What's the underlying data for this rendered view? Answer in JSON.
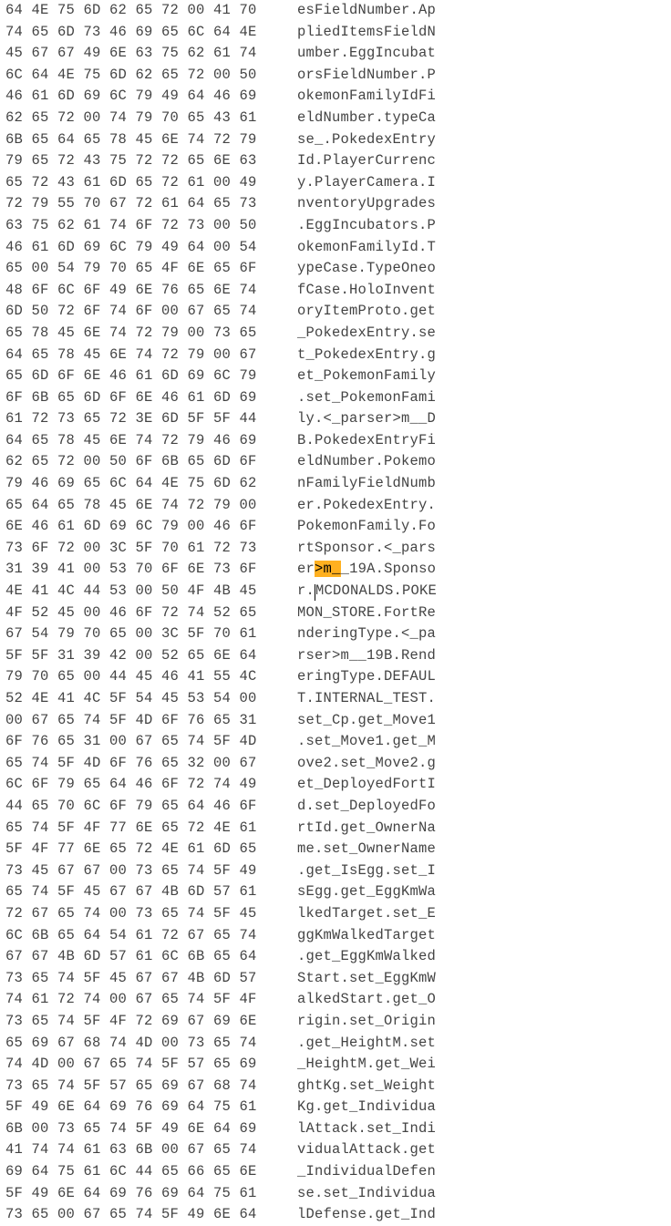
{
  "highlight": {
    "row": 26,
    "start": 2,
    "end": 5
  },
  "caret": {
    "row": 27,
    "col": 2
  },
  "rows": [
    {
      "hex": [
        "64",
        "4E",
        "75",
        "6D",
        "62",
        "65",
        "72",
        "00",
        "41",
        "70"
      ],
      "ascii": "esFieldNumber.Ap"
    },
    {
      "hex": [
        "74",
        "65",
        "6D",
        "73",
        "46",
        "69",
        "65",
        "6C",
        "64",
        "4E"
      ],
      "ascii": "pliedItemsFieldN"
    },
    {
      "hex": [
        "45",
        "67",
        "67",
        "49",
        "6E",
        "63",
        "75",
        "62",
        "61",
        "74"
      ],
      "ascii": "umber.EggIncubat"
    },
    {
      "hex": [
        "6C",
        "64",
        "4E",
        "75",
        "6D",
        "62",
        "65",
        "72",
        "00",
        "50"
      ],
      "ascii": "orsFieldNumber.P"
    },
    {
      "hex": [
        "46",
        "61",
        "6D",
        "69",
        "6C",
        "79",
        "49",
        "64",
        "46",
        "69"
      ],
      "ascii": "okemonFamilyIdFi"
    },
    {
      "hex": [
        "62",
        "65",
        "72",
        "00",
        "74",
        "79",
        "70",
        "65",
        "43",
        "61"
      ],
      "ascii": "eldNumber.typeCa"
    },
    {
      "hex": [
        "6B",
        "65",
        "64",
        "65",
        "78",
        "45",
        "6E",
        "74",
        "72",
        "79"
      ],
      "ascii": "se_.PokedexEntry"
    },
    {
      "hex": [
        "79",
        "65",
        "72",
        "43",
        "75",
        "72",
        "72",
        "65",
        "6E",
        "63"
      ],
      "ascii": "Id.PlayerCurrenc"
    },
    {
      "hex": [
        "65",
        "72",
        "43",
        "61",
        "6D",
        "65",
        "72",
        "61",
        "00",
        "49"
      ],
      "ascii": "y.PlayerCamera.I"
    },
    {
      "hex": [
        "72",
        "79",
        "55",
        "70",
        "67",
        "72",
        "61",
        "64",
        "65",
        "73"
      ],
      "ascii": "nventoryUpgrades"
    },
    {
      "hex": [
        "63",
        "75",
        "62",
        "61",
        "74",
        "6F",
        "72",
        "73",
        "00",
        "50"
      ],
      "ascii": ".EggIncubators.P"
    },
    {
      "hex": [
        "46",
        "61",
        "6D",
        "69",
        "6C",
        "79",
        "49",
        "64",
        "00",
        "54"
      ],
      "ascii": "okemonFamilyId.T"
    },
    {
      "hex": [
        "65",
        "00",
        "54",
        "79",
        "70",
        "65",
        "4F",
        "6E",
        "65",
        "6F"
      ],
      "ascii": "ypeCase.TypeOneo"
    },
    {
      "hex": [
        "48",
        "6F",
        "6C",
        "6F",
        "49",
        "6E",
        "76",
        "65",
        "6E",
        "74"
      ],
      "ascii": "fCase.HoloInvent"
    },
    {
      "hex": [
        "6D",
        "50",
        "72",
        "6F",
        "74",
        "6F",
        "00",
        "67",
        "65",
        "74"
      ],
      "ascii": "oryItemProto.get"
    },
    {
      "hex": [
        "65",
        "78",
        "45",
        "6E",
        "74",
        "72",
        "79",
        "00",
        "73",
        "65"
      ],
      "ascii": "_PokedexEntry.se"
    },
    {
      "hex": [
        "64",
        "65",
        "78",
        "45",
        "6E",
        "74",
        "72",
        "79",
        "00",
        "67"
      ],
      "ascii": "t_PokedexEntry.g"
    },
    {
      "hex": [
        "65",
        "6D",
        "6F",
        "6E",
        "46",
        "61",
        "6D",
        "69",
        "6C",
        "79"
      ],
      "ascii": "et_PokemonFamily"
    },
    {
      "hex": [
        "6F",
        "6B",
        "65",
        "6D",
        "6F",
        "6E",
        "46",
        "61",
        "6D",
        "69"
      ],
      "ascii": ".set_PokemonFami"
    },
    {
      "hex": [
        "61",
        "72",
        "73",
        "65",
        "72",
        "3E",
        "6D",
        "5F",
        "5F",
        "44"
      ],
      "ascii": "ly.<_parser>m__D"
    },
    {
      "hex": [
        "64",
        "65",
        "78",
        "45",
        "6E",
        "74",
        "72",
        "79",
        "46",
        "69"
      ],
      "ascii": "B.PokedexEntryFi"
    },
    {
      "hex": [
        "62",
        "65",
        "72",
        "00",
        "50",
        "6F",
        "6B",
        "65",
        "6D",
        "6F"
      ],
      "ascii": "eldNumber.Pokemo"
    },
    {
      "hex": [
        "79",
        "46",
        "69",
        "65",
        "6C",
        "64",
        "4E",
        "75",
        "6D",
        "62"
      ],
      "ascii": "nFamilyFieldNumb"
    },
    {
      "hex": [
        "65",
        "64",
        "65",
        "78",
        "45",
        "6E",
        "74",
        "72",
        "79",
        "00"
      ],
      "ascii": "er.PokedexEntry."
    },
    {
      "hex": [
        "6E",
        "46",
        "61",
        "6D",
        "69",
        "6C",
        "79",
        "00",
        "46",
        "6F"
      ],
      "ascii": "PokemonFamily.Fo"
    },
    {
      "hex": [
        "73",
        "6F",
        "72",
        "00",
        "3C",
        "5F",
        "70",
        "61",
        "72",
        "73"
      ],
      "ascii": "rtSponsor.<_pars"
    },
    {
      "hex": [
        "31",
        "39",
        "41",
        "00",
        "53",
        "70",
        "6F",
        "6E",
        "73",
        "6F"
      ],
      "ascii": "er>m__19A.Sponso"
    },
    {
      "hex": [
        "4E",
        "41",
        "4C",
        "44",
        "53",
        "00",
        "50",
        "4F",
        "4B",
        "45"
      ],
      "ascii": "r.MCDONALDS.POKE"
    },
    {
      "hex": [
        "4F",
        "52",
        "45",
        "00",
        "46",
        "6F",
        "72",
        "74",
        "52",
        "65"
      ],
      "ascii": "MON_STORE.FortRe"
    },
    {
      "hex": [
        "67",
        "54",
        "79",
        "70",
        "65",
        "00",
        "3C",
        "5F",
        "70",
        "61"
      ],
      "ascii": "nderingType.<_pa"
    },
    {
      "hex": [
        "5F",
        "5F",
        "31",
        "39",
        "42",
        "00",
        "52",
        "65",
        "6E",
        "64"
      ],
      "ascii": "rser>m__19B.Rend"
    },
    {
      "hex": [
        "79",
        "70",
        "65",
        "00",
        "44",
        "45",
        "46",
        "41",
        "55",
        "4C"
      ],
      "ascii": "eringType.DEFAUL"
    },
    {
      "hex": [
        "52",
        "4E",
        "41",
        "4C",
        "5F",
        "54",
        "45",
        "53",
        "54",
        "00"
      ],
      "ascii": "T.INTERNAL_TEST."
    },
    {
      "hex": [
        "00",
        "67",
        "65",
        "74",
        "5F",
        "4D",
        "6F",
        "76",
        "65",
        "31"
      ],
      "ascii": "set_Cp.get_Move1"
    },
    {
      "hex": [
        "6F",
        "76",
        "65",
        "31",
        "00",
        "67",
        "65",
        "74",
        "5F",
        "4D"
      ],
      "ascii": ".set_Move1.get_M"
    },
    {
      "hex": [
        "65",
        "74",
        "5F",
        "4D",
        "6F",
        "76",
        "65",
        "32",
        "00",
        "67"
      ],
      "ascii": "ove2.set_Move2.g"
    },
    {
      "hex": [
        "6C",
        "6F",
        "79",
        "65",
        "64",
        "46",
        "6F",
        "72",
        "74",
        "49"
      ],
      "ascii": "et_DeployedFortI"
    },
    {
      "hex": [
        "44",
        "65",
        "70",
        "6C",
        "6F",
        "79",
        "65",
        "64",
        "46",
        "6F"
      ],
      "ascii": "d.set_DeployedFo"
    },
    {
      "hex": [
        "65",
        "74",
        "5F",
        "4F",
        "77",
        "6E",
        "65",
        "72",
        "4E",
        "61"
      ],
      "ascii": "rtId.get_OwnerNa"
    },
    {
      "hex": [
        "5F",
        "4F",
        "77",
        "6E",
        "65",
        "72",
        "4E",
        "61",
        "6D",
        "65"
      ],
      "ascii": "me.set_OwnerName"
    },
    {
      "hex": [
        "73",
        "45",
        "67",
        "67",
        "00",
        "73",
        "65",
        "74",
        "5F",
        "49"
      ],
      "ascii": ".get_IsEgg.set_I"
    },
    {
      "hex": [
        "65",
        "74",
        "5F",
        "45",
        "67",
        "67",
        "4B",
        "6D",
        "57",
        "61"
      ],
      "ascii": "sEgg.get_EggKmWa"
    },
    {
      "hex": [
        "72",
        "67",
        "65",
        "74",
        "00",
        "73",
        "65",
        "74",
        "5F",
        "45"
      ],
      "ascii": "lkedTarget.set_E"
    },
    {
      "hex": [
        "6C",
        "6B",
        "65",
        "64",
        "54",
        "61",
        "72",
        "67",
        "65",
        "74"
      ],
      "ascii": "ggKmWalkedTarget"
    },
    {
      "hex": [
        "67",
        "67",
        "4B",
        "6D",
        "57",
        "61",
        "6C",
        "6B",
        "65",
        "64"
      ],
      "ascii": ".get_EggKmWalked"
    },
    {
      "hex": [
        "73",
        "65",
        "74",
        "5F",
        "45",
        "67",
        "67",
        "4B",
        "6D",
        "57"
      ],
      "ascii": "Start.set_EggKmW"
    },
    {
      "hex": [
        "74",
        "61",
        "72",
        "74",
        "00",
        "67",
        "65",
        "74",
        "5F",
        "4F"
      ],
      "ascii": "alkedStart.get_O"
    },
    {
      "hex": [
        "73",
        "65",
        "74",
        "5F",
        "4F",
        "72",
        "69",
        "67",
        "69",
        "6E"
      ],
      "ascii": "rigin.set_Origin"
    },
    {
      "hex": [
        "65",
        "69",
        "67",
        "68",
        "74",
        "4D",
        "00",
        "73",
        "65",
        "74"
      ],
      "ascii": ".get_HeightM.set"
    },
    {
      "hex": [
        "74",
        "4D",
        "00",
        "67",
        "65",
        "74",
        "5F",
        "57",
        "65",
        "69"
      ],
      "ascii": "_HeightM.get_Wei"
    },
    {
      "hex": [
        "73",
        "65",
        "74",
        "5F",
        "57",
        "65",
        "69",
        "67",
        "68",
        "74"
      ],
      "ascii": "ghtKg.set_Weight"
    },
    {
      "hex": [
        "5F",
        "49",
        "6E",
        "64",
        "69",
        "76",
        "69",
        "64",
        "75",
        "61"
      ],
      "ascii": "Kg.get_Individua"
    },
    {
      "hex": [
        "6B",
        "00",
        "73",
        "65",
        "74",
        "5F",
        "49",
        "6E",
        "64",
        "69"
      ],
      "ascii": "lAttack.set_Indi"
    },
    {
      "hex": [
        "41",
        "74",
        "74",
        "61",
        "63",
        "6B",
        "00",
        "67",
        "65",
        "74"
      ],
      "ascii": "vidualAttack.get"
    },
    {
      "hex": [
        "69",
        "64",
        "75",
        "61",
        "6C",
        "44",
        "65",
        "66",
        "65",
        "6E"
      ],
      "ascii": "_IndividualDefen"
    },
    {
      "hex": [
        "5F",
        "49",
        "6E",
        "64",
        "69",
        "76",
        "69",
        "64",
        "75",
        "61"
      ],
      "ascii": "se.set_Individua"
    },
    {
      "hex": [
        "73",
        "65",
        "00",
        "67",
        "65",
        "74",
        "5F",
        "49",
        "6E",
        "64"
      ],
      "ascii": "lDefense.get_Ind"
    }
  ]
}
